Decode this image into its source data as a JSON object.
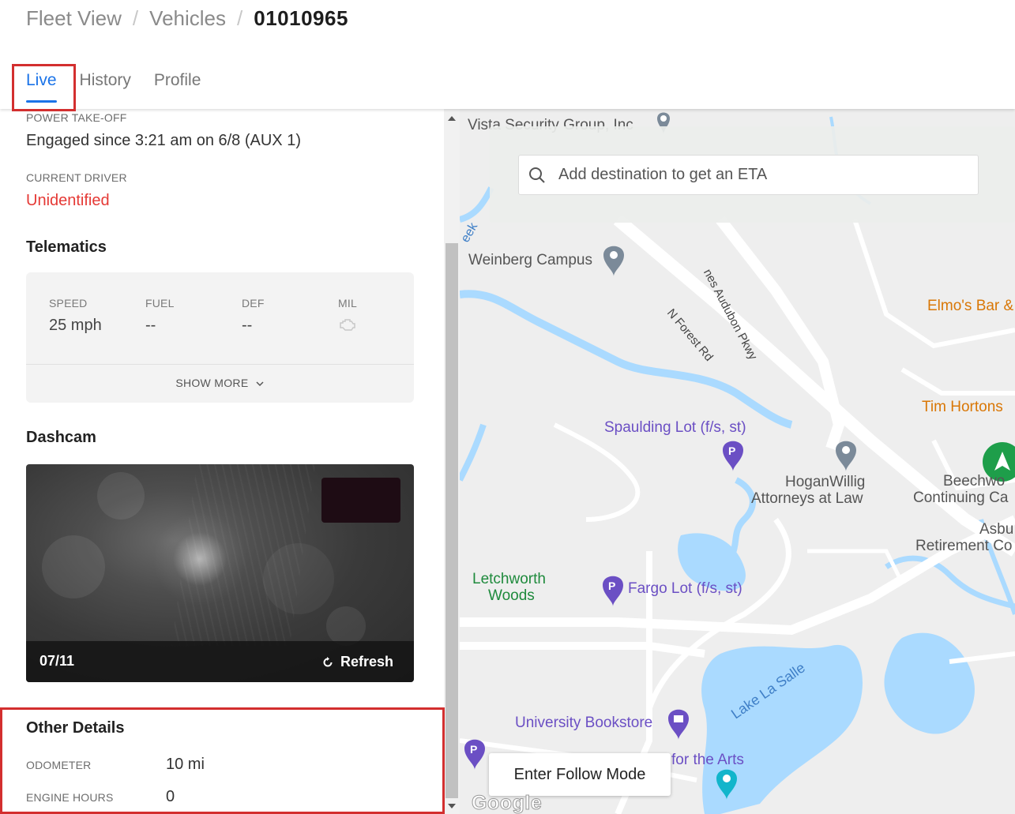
{
  "breadcrumb": {
    "items": [
      "Fleet View",
      "Vehicles"
    ],
    "separator": "/",
    "current": "01010965"
  },
  "tabs": [
    {
      "label": "Live",
      "active": true
    },
    {
      "label": "History",
      "active": false
    },
    {
      "label": "Profile",
      "active": false
    }
  ],
  "vehicle": {
    "pto_label": "POWER TAKE-OFF",
    "pto_value": "Engaged since 3:21 am on 6/8 (AUX 1)",
    "driver_label": "CURRENT DRIVER",
    "driver_value": "Unidentified"
  },
  "telematics": {
    "title": "Telematics",
    "metrics": [
      {
        "label": "SPEED",
        "value": "25 mph"
      },
      {
        "label": "FUEL",
        "value": "--"
      },
      {
        "label": "DEF",
        "value": "--"
      },
      {
        "label": "MIL",
        "value": "",
        "icon": "engine-icon"
      }
    ],
    "show_more": "SHOW MORE"
  },
  "dashcam": {
    "title": "Dashcam",
    "date": "07/11",
    "refresh": "Refresh"
  },
  "other_details": {
    "title": "Other Details",
    "odometer_label": "ODOMETER",
    "odometer_value": "10 mi",
    "engine_hours_label": "ENGINE HOURS",
    "engine_hours_value": "0"
  },
  "map": {
    "search_placeholder": "Add destination to get an ETA",
    "follow_button": "Enter Follow Mode",
    "attribution": "Google",
    "labels": {
      "vista": "Vista Security Group, Inc",
      "creek": "eek",
      "weinberg": "Weinberg Campus",
      "audubon": "nes Audubon Pkwy",
      "forest": "N Forest Rd",
      "elmos": "Elmo's Bar &",
      "tim": "Tim Hortons",
      "spaulding": "Spaulding Lot (f/s, st)",
      "hogan1": "HoganWillig",
      "hogan2": "Attorneys at Law",
      "beech1": "Beechwo",
      "beech2": "Continuing Ca",
      "asbu1": "Asbu",
      "asbu2": "Retirement Co",
      "letch1": "Letchworth",
      "letch2": "Woods",
      "fargo": "Fargo Lot (f/s, st)",
      "lake": "Lake La Salle",
      "bookstore": "University Bookstore",
      "arts": "for the Arts"
    },
    "colors": {
      "water": "#aadaff",
      "road": "#ffffff",
      "land": "#eeeeee",
      "poi_purple": "#6b4fc4",
      "poi_gray": "#7b8a99",
      "vehicle_green": "#1e9e4a"
    }
  },
  "colors": {
    "accent": "#1a73e8",
    "alert": "#e53935",
    "highlight_box": "#d32f2f"
  }
}
